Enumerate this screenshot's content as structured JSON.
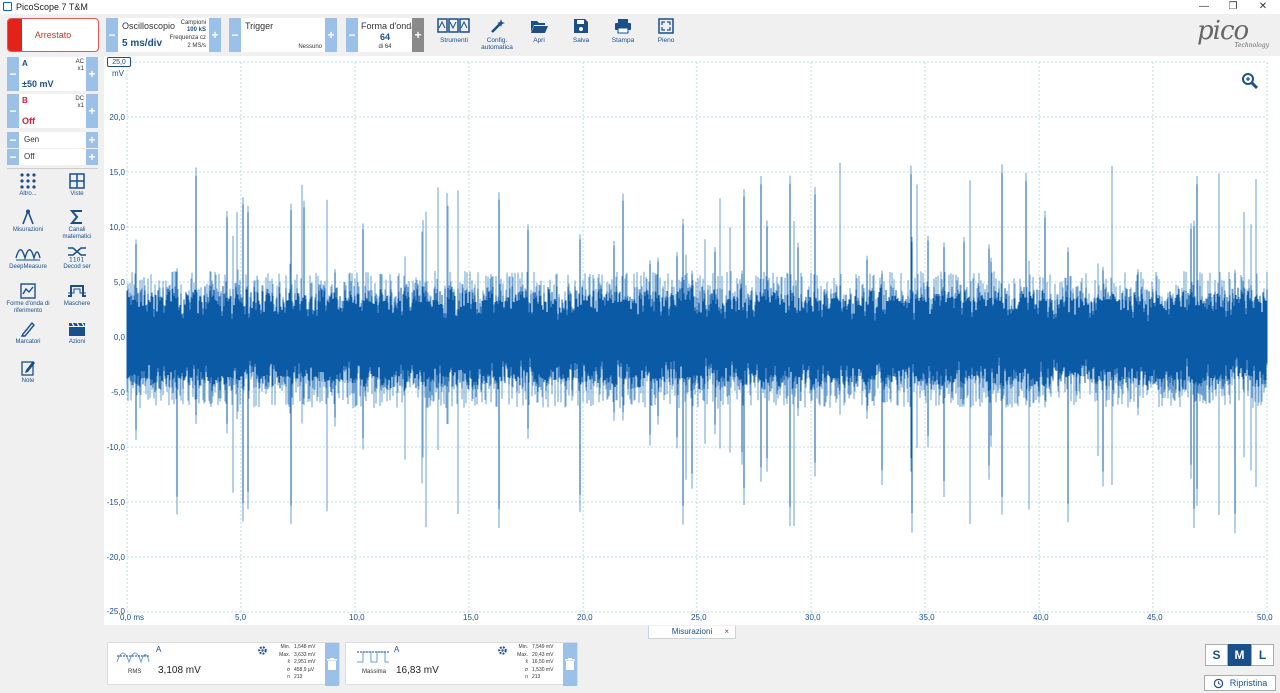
{
  "window": {
    "title": "PicoScope 7 T&M"
  },
  "run": {
    "label": "Arrestato"
  },
  "scope": {
    "title": "Oscilloscopio",
    "timebase": "5 ms/div",
    "samples_label": "Campioni",
    "samples": "100 kS",
    "rate_label": "Frequenza cz",
    "rate": "2 MS/s"
  },
  "trigger": {
    "title": "Trigger",
    "mode": "Nessuno"
  },
  "waveform": {
    "title": "Forma d'onda",
    "count": "64",
    "of": "di 64"
  },
  "toolbar": {
    "tools": "Strumenti",
    "autosetup": "Config. automatica",
    "open": "Apri",
    "save": "Salva",
    "print": "Stampa",
    "full": "Pieno"
  },
  "logo": {
    "brand": "pico",
    "sub": "Technology"
  },
  "channels": {
    "a": {
      "name": "A",
      "coupling": "AC",
      "probe": "x1",
      "range": "±50 mV"
    },
    "b": {
      "name": "B",
      "coupling": "DC",
      "probe": "x1",
      "range": "Off"
    },
    "gen": {
      "name": "Gen",
      "state": "Off"
    }
  },
  "sidebar": {
    "more": "Altro...",
    "views": "Viste",
    "measurements": "Misurazioni",
    "math": "Canali matematici",
    "deepmeasure": "DeepMeasure",
    "decode": "Decod ser",
    "reference": "Forme d'onda di riferimento",
    "masks": "Maschere",
    "markers": "Marcatori",
    "actions": "Azioni",
    "notes": "Note"
  },
  "plot": {
    "y_unit": "mV",
    "y_ticks": [
      "25,0",
      "20,0",
      "15,0",
      "10,0",
      "5,0",
      "0,0",
      "-5,0",
      "-10,0",
      "-15,0",
      "-20,0",
      "-25,0"
    ],
    "x_ticks": [
      "0,0 ms",
      "5,0",
      "10,0",
      "15,0",
      "20,0",
      "25,0",
      "30,0",
      "35,0",
      "40,0",
      "45,0",
      "50,0"
    ],
    "trace_color": "#0a5aa6",
    "trace_light": "#6a9fd0"
  },
  "chart_data": {
    "type": "line",
    "series": [
      {
        "values_description_free": true
      }
    ],
    "xlim": [
      0,
      50
    ],
    "ylim": [
      -25,
      25
    ],
    "ylabel": "mV",
    "xlabel": "ms",
    "grid": true
  },
  "meas_tab": {
    "label": "Misurazioni",
    "close": "×"
  },
  "measurements": [
    {
      "channel": "A",
      "type": "RMS",
      "value": "3,108 mV",
      "stats": [
        [
          "Min.",
          "1,548 mV"
        ],
        [
          "Max.",
          "3,633 mV"
        ],
        [
          "x̄",
          "2,951 mV"
        ],
        [
          "σ",
          "458,9 µV"
        ],
        [
          "n",
          "213"
        ]
      ]
    },
    {
      "channel": "A",
      "type": "Massima",
      "value": "16,83 mV",
      "stats": [
        [
          "Min.",
          "7,549 mV"
        ],
        [
          "Max.",
          "20,43 mV"
        ],
        [
          "x̄",
          "16,50 mV"
        ],
        [
          "σ",
          "1,530 mV"
        ],
        [
          "n",
          "213"
        ]
      ]
    }
  ],
  "size": {
    "s": "S",
    "m": "M",
    "l": "L"
  },
  "reset": {
    "label": "Ripristina"
  }
}
